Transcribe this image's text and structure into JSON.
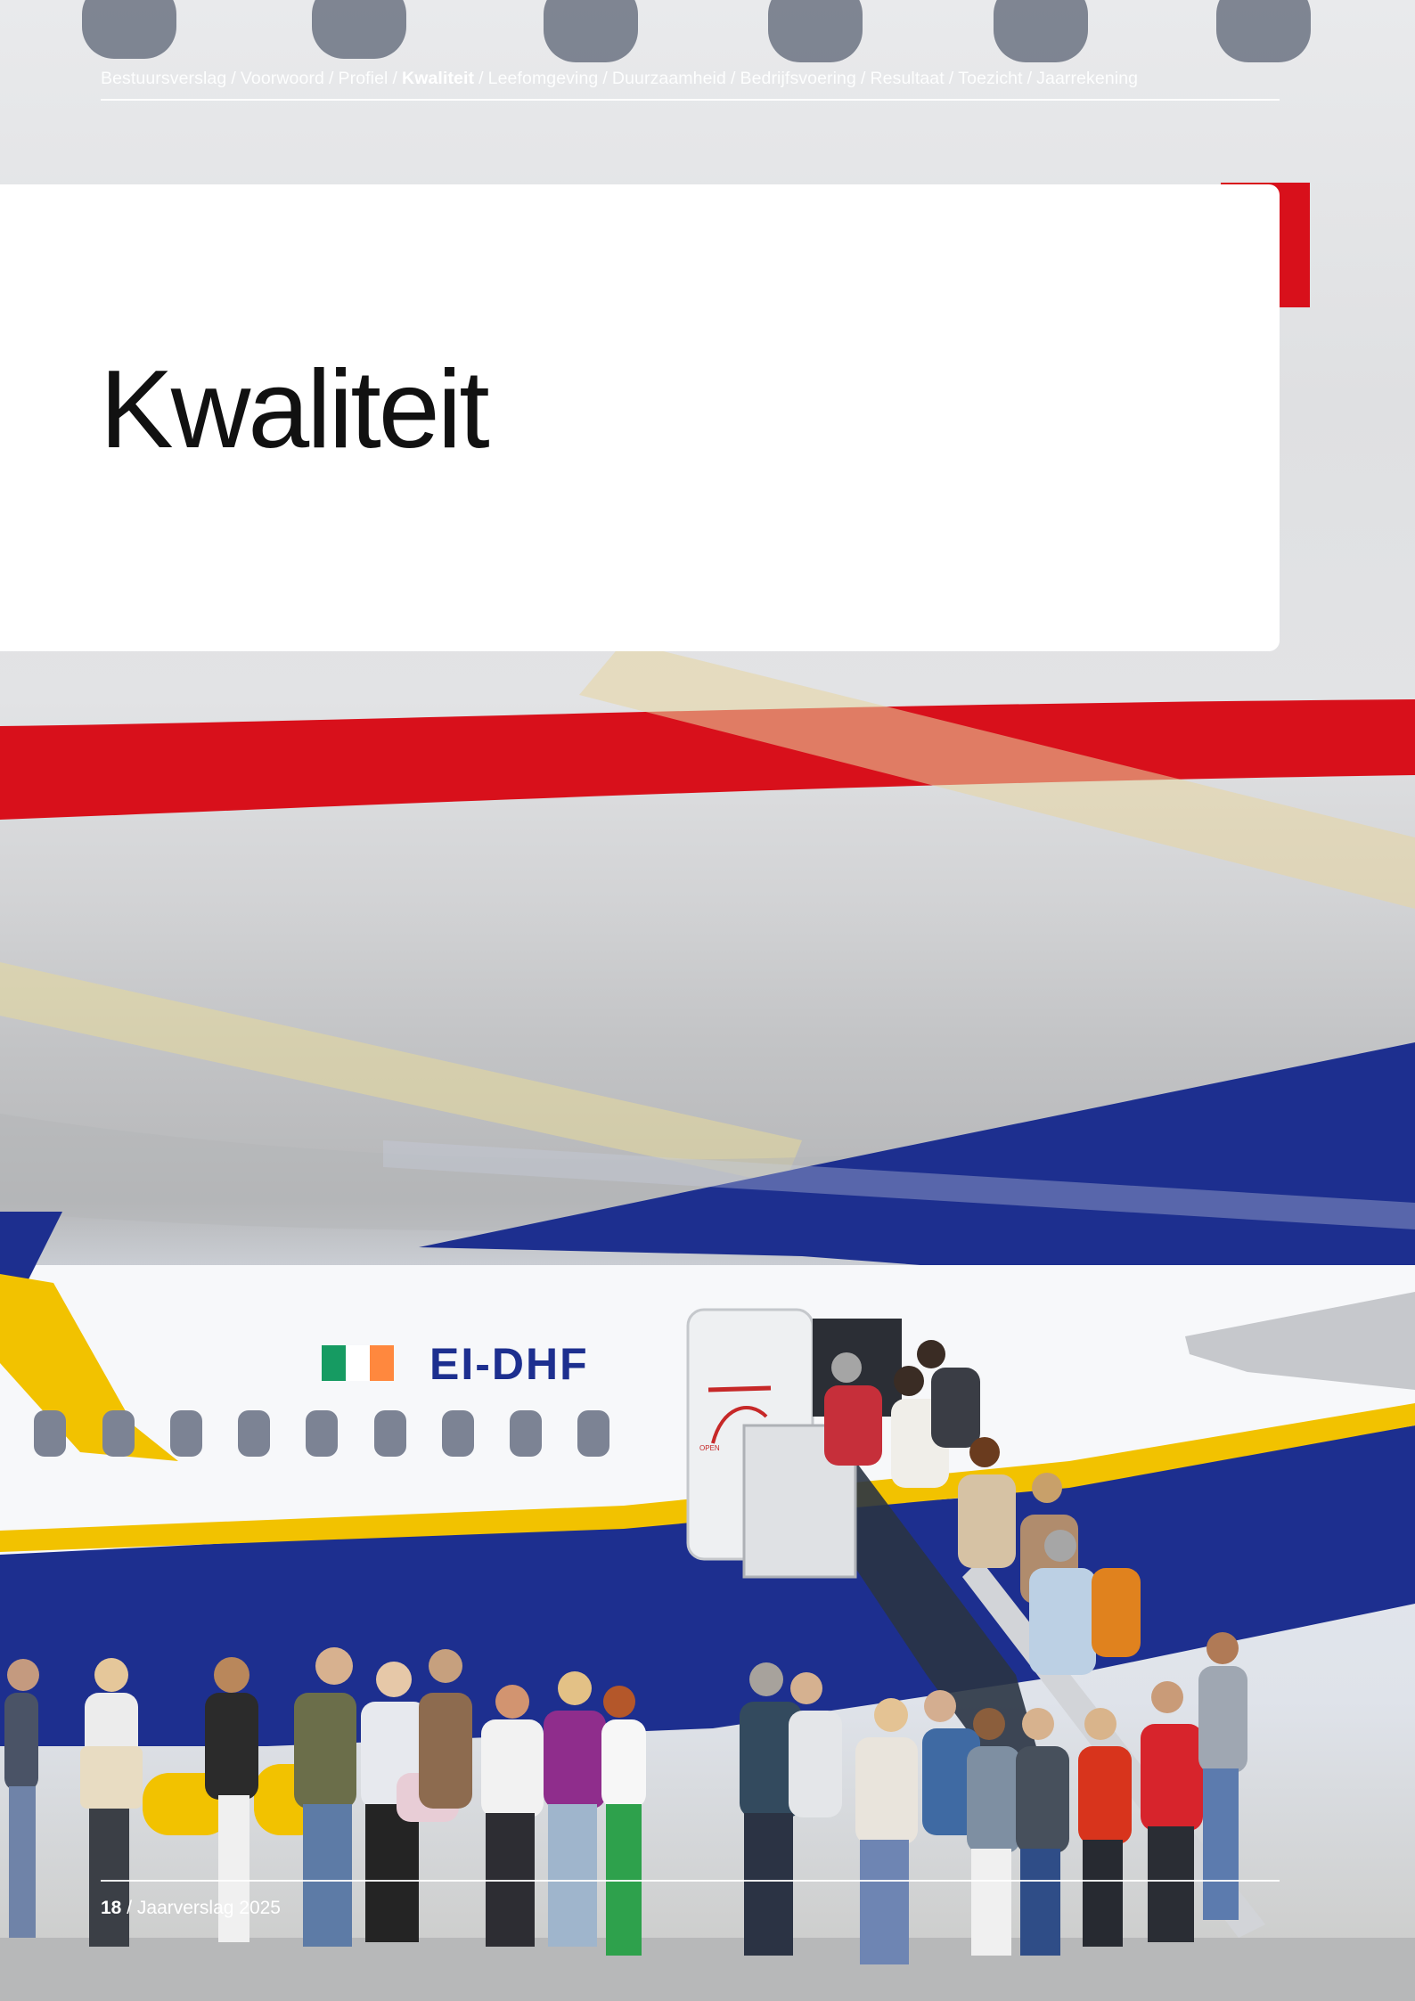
{
  "breadcrumb": {
    "items": [
      {
        "label": "Bestuursverslag"
      },
      {
        "label": "Voorwoord"
      },
      {
        "label": "Profiel"
      },
      {
        "label": "Kwaliteit",
        "active": true
      },
      {
        "label": "Leefomgeving"
      },
      {
        "label": "Duurzaamheid"
      },
      {
        "label": "Bedrijfsvoering"
      },
      {
        "label": "Resultaat"
      },
      {
        "label": "Toezicht"
      },
      {
        "label": "Jaarrekening"
      }
    ],
    "separator": "/"
  },
  "page": {
    "title": "Kwaliteit"
  },
  "photo": {
    "registration": "EI-DHF",
    "door_label": "OPEN"
  },
  "footer": {
    "page_number": "18",
    "separator": "/",
    "publication": "Jaarverslag 2025"
  },
  "colors": {
    "airline_blue": "#1d2f8f",
    "airline_yellow": "#f2c200",
    "stripe_red": "#d8101b",
    "title_text": "#111111"
  }
}
